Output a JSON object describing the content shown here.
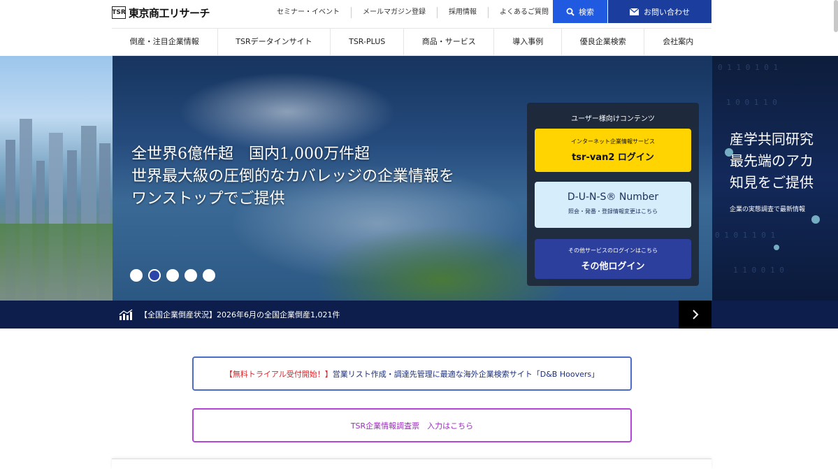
{
  "header": {
    "logo_mark": "TSR",
    "logo_text": "東京商工リサーチ",
    "util_nav": [
      "セミナー・イベント",
      "メールマガジン登録",
      "採用情報",
      "よくあるご質問"
    ],
    "search_label": "検索",
    "contact_label": "お問い合わせ"
  },
  "main_nav": [
    "倒産・注目企業情報",
    "TSRデータインサイト",
    "TSR-PLUS",
    "商品・サービス",
    "導入事例",
    "優良企業検索",
    "会社案内"
  ],
  "hero": {
    "line1": "全世界6億件超　国内1,000万件超",
    "line2": "世界最大級の圧倒的なカバレッジの企業情報を",
    "line3": "ワンストップでご提供",
    "right_line1": "産学共同研究",
    "right_line2": "最先端のアカ",
    "right_line3": "知見をご提供",
    "right_sub": "企業の実態調査で最新情報",
    "active_dot": 2,
    "dot_count": 5
  },
  "user_panel": {
    "title": "ユーザー様向けコンテンツ",
    "tsrvan2_small": "インターネット企業情報サービス",
    "tsrvan2_big": "tsr-van2 ログイン",
    "duns_big": "D-U-N-S® Number",
    "duns_small": "照会・発番・登録情報変更はこちら",
    "other_small": "その他サービスのログインはこちら",
    "other_big": "その他ログイン"
  },
  "ticker": {
    "text": "【全国企業倒産状況】2026年6月の全国企業倒産1,021件"
  },
  "banners": {
    "trial_red": "【無料トライアル受付開始！】",
    "trial_text": "営業リスト作成・調達先管理に最適な海外企業検索サイト「D&B Hoovers」",
    "survey_text": "TSR企業情報調査票　入力はこちら"
  }
}
